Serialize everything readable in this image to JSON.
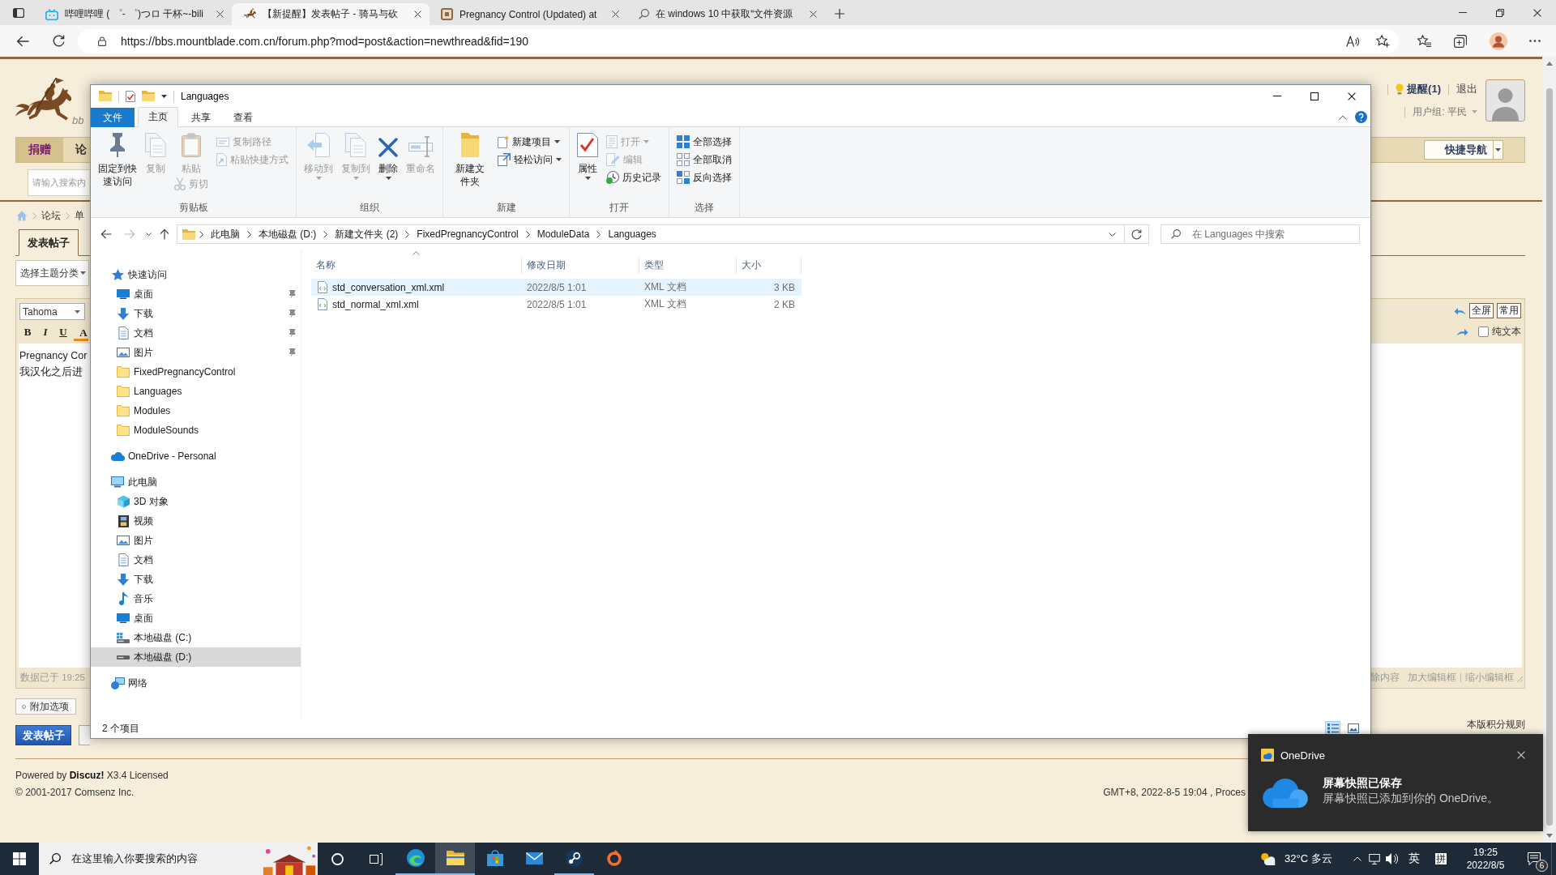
{
  "browser": {
    "tabs": [
      {
        "title": "哔哩哔哩 ( ゜- ゜)つロ 干杯~-bili",
        "kind": "video",
        "selected": false
      },
      {
        "title": "【新提醒】发表帖子 - 骑马与砍",
        "kind": "forum",
        "selected": true
      },
      {
        "title": "Pregnancy Control (Updated) at",
        "kind": "mod",
        "selected": false
      },
      {
        "title": "在 windows 10 中获取“文件资源",
        "kind": "search",
        "selected": false
      }
    ],
    "url": "https://bbs.mountblade.com.cn/forum.php?mod=post&action=newthread&fid=190"
  },
  "forum": {
    "logo_text": "bb",
    "user_links": [
      {
        "label": "提醒(1)",
        "kind": "alert"
      },
      {
        "label": "退出",
        "kind": "plain"
      }
    ],
    "user_group": "用户组: 平民",
    "nav": [
      {
        "label": "捐赠",
        "selected": true
      },
      {
        "label": "论",
        "selected": false
      }
    ],
    "quick_nav": "快捷导航",
    "search": {
      "placeholder": "请输入搜索内"
    },
    "breadcrumb": [
      "论坛",
      "单"
    ],
    "post_tab": "发表帖子",
    "category_select": "选择主题分类",
    "editor": {
      "font": "Tahoma",
      "format_buttons": [
        {
          "label": "B",
          "kind": "bold"
        },
        {
          "label": "I",
          "kind": "italic"
        },
        {
          "label": "U",
          "kind": "underline"
        },
        {
          "label": "A",
          "kind": "color"
        }
      ],
      "mode_buttons": [
        "全屏",
        "常用"
      ],
      "plain_text": {
        "label": "纯文本",
        "checked": false
      },
      "lines": [
        "Pregnancy Cor",
        "我汉化之后进"
      ],
      "autosave": "数据已于 19:25",
      "footer_links": [
        "除内容",
        "加大编辑框",
        "缩小编辑框"
      ]
    },
    "extra_options": "附加选项",
    "submit": "发表帖子",
    "rules_link": "本版积分规则",
    "footer": {
      "powered": "Powered by **Discuz!** X3.4 Licensed",
      "copyright": "© 2001-2017 Comsenz Inc.",
      "server_info": "GMT+8, 2022-8-5 19:04 , Proces"
    }
  },
  "explorer": {
    "title": "Languages",
    "ribbon_tabs": [
      {
        "label": "文件",
        "kind": "menu",
        "selected": false
      },
      {
        "label": "主页",
        "kind": "tab",
        "selected": true
      },
      {
        "label": "共享",
        "kind": "tab",
        "selected": false
      },
      {
        "label": "查看",
        "kind": "tab",
        "selected": false
      }
    ],
    "ribbon_groups": [
      {
        "label": "剪贴板",
        "columns": [
          [
            {
              "label": "固定到快速访问",
              "kind": "large",
              "disabled": false,
              "dropdown": false
            }
          ],
          [
            {
              "label": "复制",
              "kind": "large",
              "disabled": true,
              "dropdown": false
            }
          ],
          [
            {
              "label": "粘贴",
              "kind": "large",
              "disabled": true,
              "dropdown": false
            },
            {
              "label": "剪切",
              "kind": "small",
              "disabled": true,
              "dropdown": false
            }
          ],
          [
            {
              "label": "复制路径",
              "kind": "small",
              "disabled": true,
              "dropdown": false
            },
            {
              "label": "粘贴快捷方式",
              "kind": "small",
              "disabled": true,
              "dropdown": false
            }
          ]
        ]
      },
      {
        "label": "组织",
        "columns": [
          [
            {
              "label": "移动到",
              "kind": "large",
              "disabled": true,
              "dropdown": true
            }
          ],
          [
            {
              "label": "复制到",
              "kind": "large",
              "disabled": true,
              "dropdown": true
            }
          ],
          [
            {
              "label": "删除",
              "kind": "large",
              "disabled": false,
              "dropdown": true
            }
          ],
          [
            {
              "label": "重命名",
              "kind": "large",
              "disabled": true,
              "dropdown": false
            }
          ]
        ]
      },
      {
        "label": "新建",
        "columns": [
          [
            {
              "label": "新建文件夹",
              "kind": "large",
              "disabled": false,
              "dropdown": false
            }
          ],
          [
            {
              "label": "新建项目",
              "kind": "small",
              "disabled": false,
              "dropdown": true
            },
            {
              "label": "轻松访问",
              "kind": "small",
              "disabled": false,
              "dropdown": true
            }
          ]
        ]
      },
      {
        "label": "打开",
        "columns": [
          [
            {
              "label": "属性",
              "kind": "large",
              "disabled": false,
              "dropdown": true
            }
          ],
          [
            {
              "label": "打开",
              "kind": "small",
              "disabled": true,
              "dropdown": true
            },
            {
              "label": "编辑",
              "kind": "small",
              "disabled": true,
              "dropdown": false
            },
            {
              "label": "历史记录",
              "kind": "small",
              "disabled": false,
              "dropdown": false
            }
          ]
        ]
      },
      {
        "label": "选择",
        "columns": [
          [
            {
              "label": "全部选择",
              "kind": "small",
              "disabled": false,
              "dropdown": false
            },
            {
              "label": "全部取消",
              "kind": "small",
              "disabled": false,
              "dropdown": false
            },
            {
              "label": "反向选择",
              "kind": "small",
              "disabled": false,
              "dropdown": false
            }
          ]
        ]
      }
    ],
    "address": {
      "path": [
        "此电脑",
        "本地磁盘 (D:)",
        "新建文件夹 (2)",
        "FixedPregnancyControl",
        "ModuleData",
        "Languages"
      ],
      "search_placeholder": "在 Languages 中搜索"
    },
    "navigation": [
      {
        "label": "快速访问",
        "kind": "quick-access",
        "selected": false,
        "children": [
          {
            "label": "桌面",
            "kind": "desktop",
            "pinned": true,
            "selected": false
          },
          {
            "label": "下载",
            "kind": "downloads",
            "pinned": true,
            "selected": false
          },
          {
            "label": "文档",
            "kind": "documents",
            "pinned": true,
            "selected": false
          },
          {
            "label": "图片",
            "kind": "pictures",
            "pinned": true,
            "selected": false
          },
          {
            "label": "FixedPregnancyControl",
            "kind": "folder",
            "pinned": false,
            "selected": false
          },
          {
            "label": "Languages",
            "kind": "folder",
            "pinned": false,
            "selected": false
          },
          {
            "label": "Modules",
            "kind": "folder",
            "pinned": false,
            "selected": false
          },
          {
            "label": "ModuleSounds",
            "kind": "folder",
            "pinned": false,
            "selected": false
          }
        ]
      },
      {
        "label": "OneDrive - Personal",
        "kind": "cloud",
        "selected": false
      },
      {
        "label": "此电脑",
        "kind": "computer",
        "selected": false,
        "children": [
          {
            "label": "3D 对象",
            "kind": "objects",
            "selected": false
          },
          {
            "label": "视频",
            "kind": "videos",
            "selected": false
          },
          {
            "label": "图片",
            "kind": "pictures",
            "selected": false
          },
          {
            "label": "文档",
            "kind": "documents",
            "selected": false
          },
          {
            "label": "下载",
            "kind": "downloads",
            "selected": false
          },
          {
            "label": "音乐",
            "kind": "music",
            "selected": false
          },
          {
            "label": "桌面",
            "kind": "desktop",
            "selected": false
          },
          {
            "label": "本地磁盘 (C:)",
            "kind": "system-drive",
            "selected": false
          },
          {
            "label": "本地磁盘 (D:)",
            "kind": "drive",
            "selected": true
          }
        ]
      },
      {
        "label": "网络",
        "kind": "network",
        "selected": false
      }
    ],
    "files": {
      "columns": [
        {
          "label": "名称",
          "sorted": true
        },
        {
          "label": "修改日期",
          "sorted": false
        },
        {
          "label": "类型",
          "sorted": false
        },
        {
          "label": "大小",
          "sorted": false
        }
      ],
      "rows": [
        {
          "name": "std_conversation_xml.xml",
          "modified": "2022/8/5 1:01",
          "type": "XML 文档",
          "size": "3 KB",
          "selected": true
        },
        {
          "name": "std_normal_xml.xml",
          "modified": "2022/8/5 1:01",
          "type": "XML 文档",
          "size": "2 KB",
          "selected": false
        }
      ]
    },
    "status": "2 个项目",
    "views": [
      {
        "kind": "details",
        "selected": true
      },
      {
        "kind": "tiles",
        "selected": false
      }
    ]
  },
  "notification": {
    "app": "OneDrive",
    "title": "屏幕快照已保存",
    "body": "屏幕快照已添加到你的 OneDrive。"
  },
  "taskbar": {
    "search_placeholder": "在这里输入你要搜索的内容",
    "apps": [
      {
        "kind": "browser",
        "running": true,
        "active": false
      },
      {
        "kind": "files",
        "running": true,
        "active": true
      },
      {
        "kind": "store",
        "running": false,
        "active": false
      },
      {
        "kind": "mail",
        "running": false,
        "active": false
      },
      {
        "kind": "game",
        "running": true,
        "active": false
      },
      {
        "kind": "launcher",
        "running": false,
        "active": false
      }
    ],
    "weather": "32°C 多云",
    "ime": "英",
    "ime_mode": "拼",
    "time": "19:25",
    "date": "2022/8/5",
    "notifications": "6"
  }
}
